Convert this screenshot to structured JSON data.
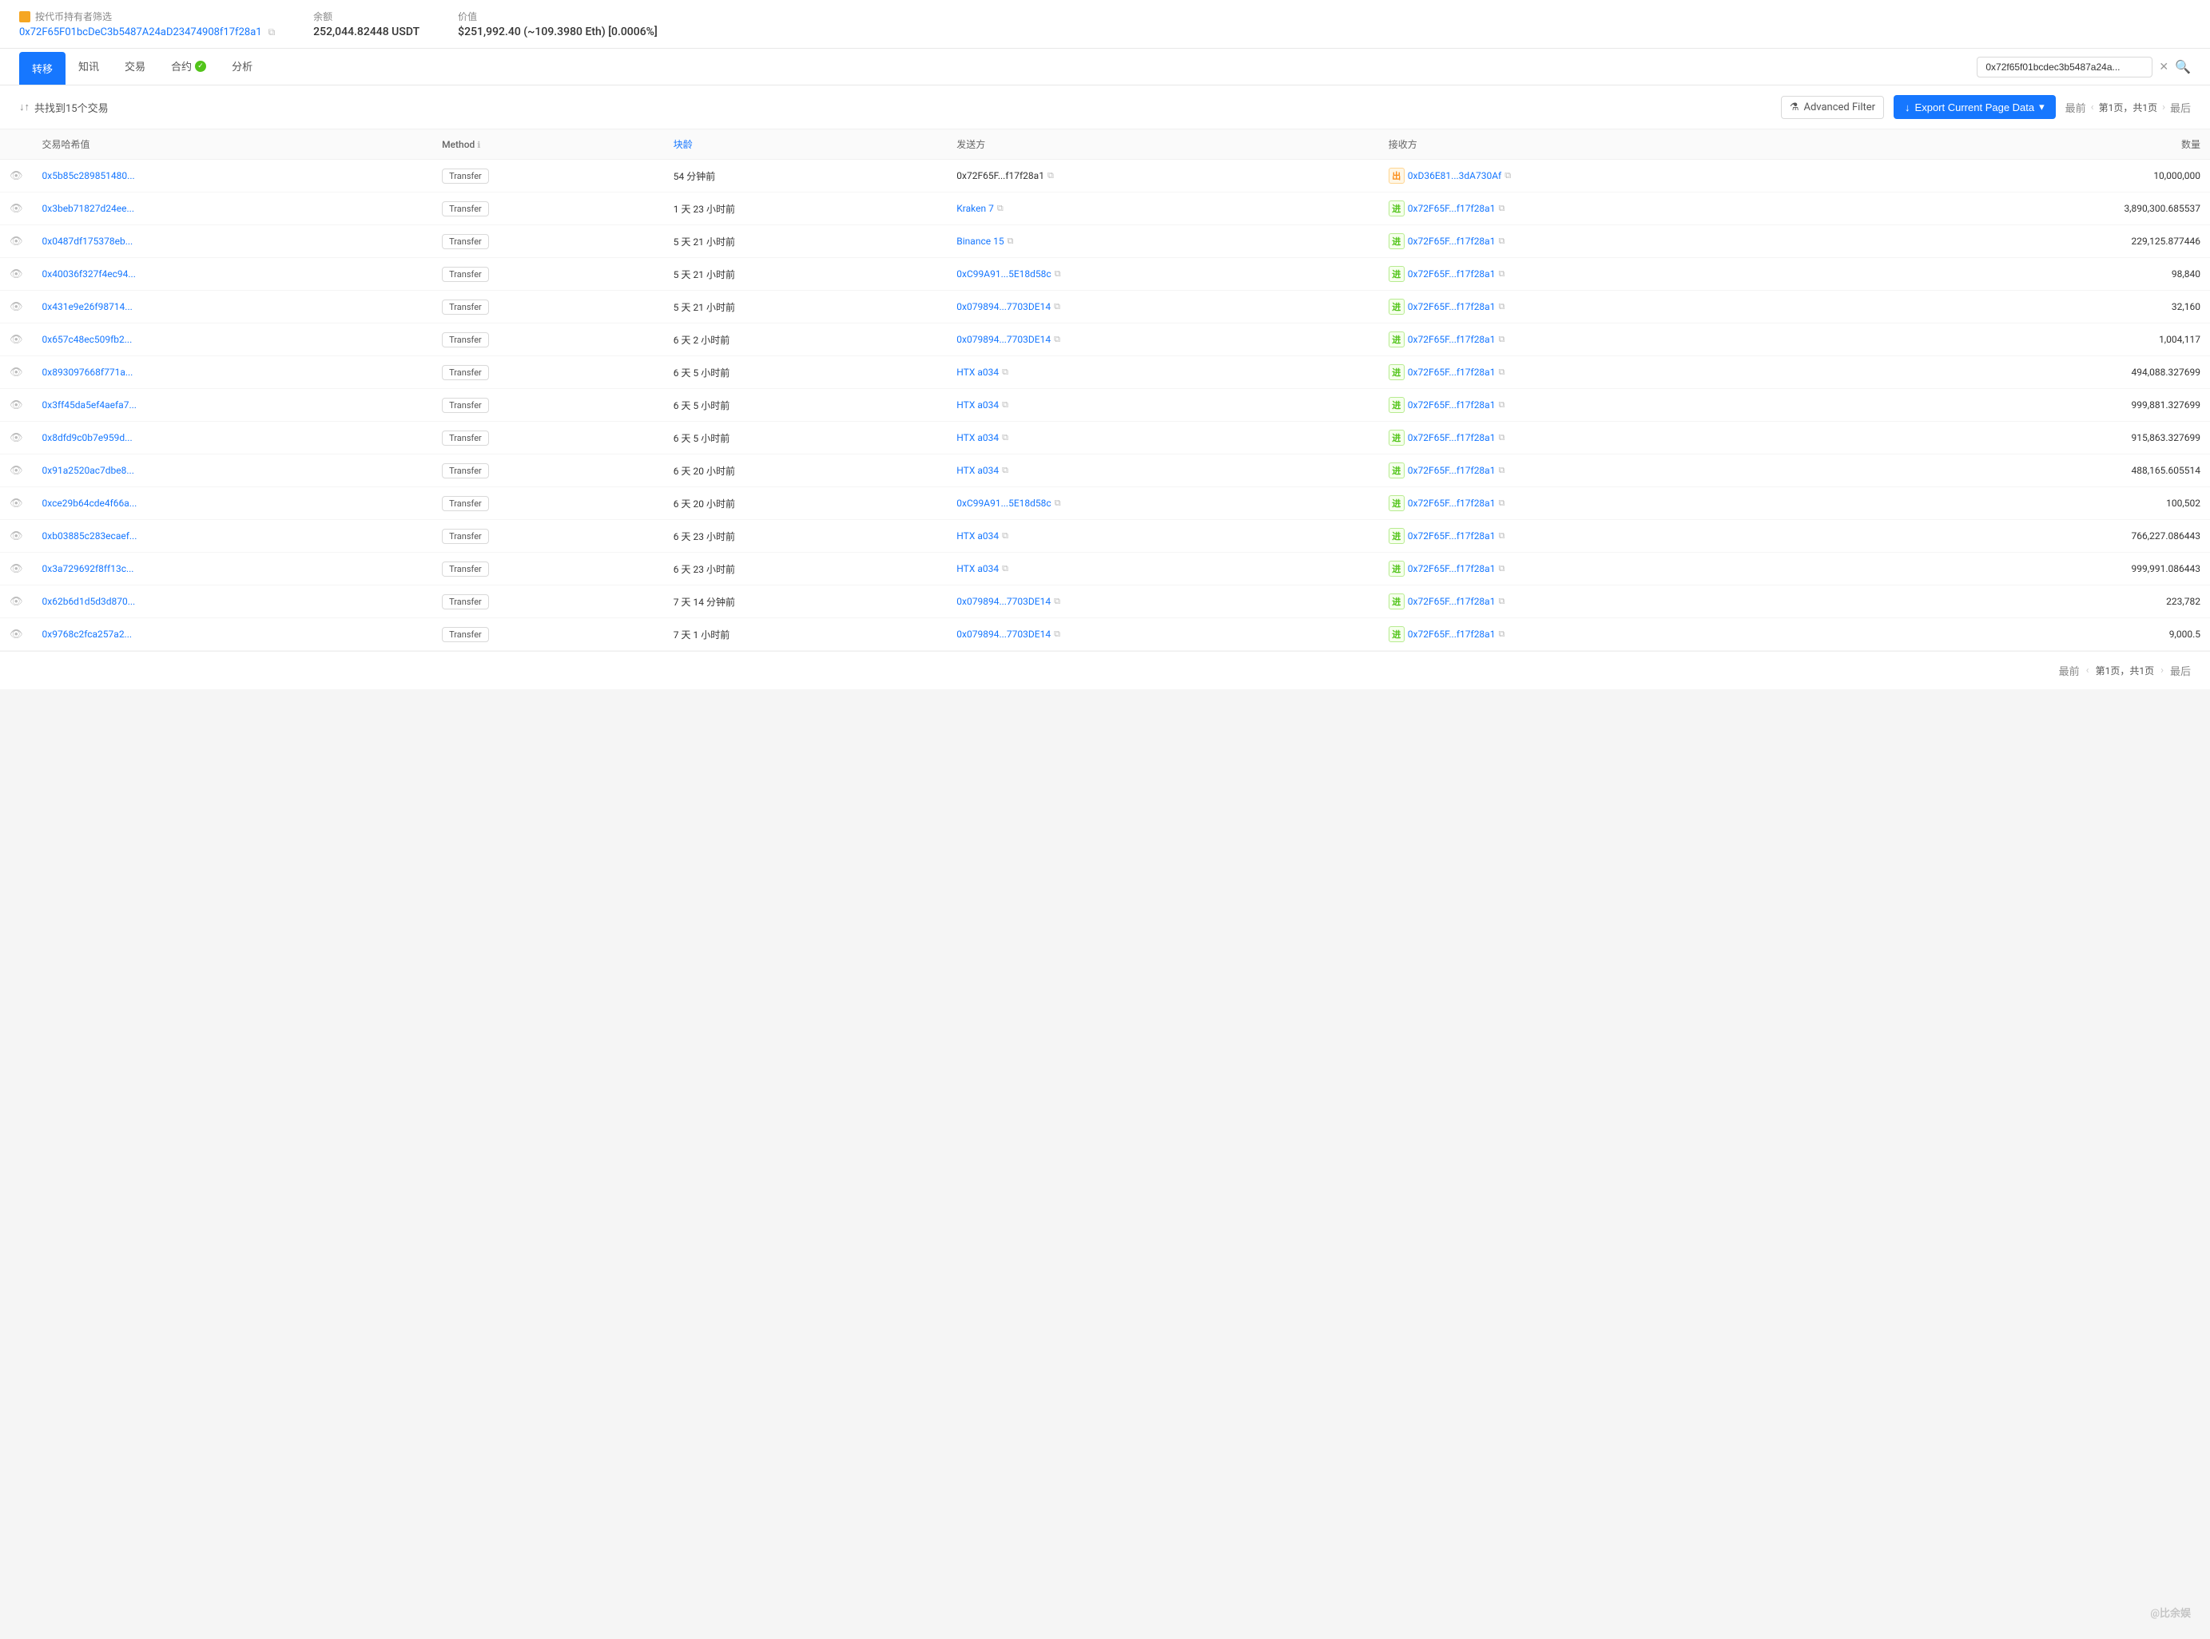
{
  "topBar": {
    "filterLabel": "按代币持有者筛选",
    "address": "0x72F65F01bcDeC3b5487A24aD23474908f17f28a1",
    "balanceLabel": "余额",
    "balanceValue": "252,044.82448 USDT",
    "valueLabel": "价值",
    "valueValue": "$251,992.40 (~109.3980 Eth) [0.0006%]"
  },
  "navTabs": [
    {
      "label": "转移",
      "active": true
    },
    {
      "label": "知讯",
      "active": false
    },
    {
      "label": "交易",
      "active": false
    },
    {
      "label": "合约",
      "active": false,
      "hasBadge": true
    },
    {
      "label": "分析",
      "active": false
    }
  ],
  "searchAddress": "0x72f65f01bcdec3b5487a24a...",
  "tableBar": {
    "sortIcon": "↓↑",
    "resultText": "共找到15个交易",
    "filterLabel": "Advanced Filter",
    "exportLabel": "Export Current Page Data",
    "firstLabel": "最前",
    "lastLabel": "最后",
    "pageInfo": "第1页，共1页"
  },
  "columns": [
    {
      "key": "eye",
      "label": ""
    },
    {
      "key": "txHash",
      "label": "交易哈希值"
    },
    {
      "key": "method",
      "label": "Method"
    },
    {
      "key": "block",
      "label": "块龄"
    },
    {
      "key": "from",
      "label": "发送方"
    },
    {
      "key": "to",
      "label": "接收方"
    },
    {
      "key": "amount",
      "label": "数量"
    }
  ],
  "rows": [
    {
      "txHash": "0x5b85c289851480...",
      "method": "Transfer",
      "block": "54 分钟前",
      "from": "0x72F65F...f17f28a1",
      "fromIsLink": false,
      "direction": "out",
      "directionLabel": "出",
      "to": "0xD36E81...3dA730Af",
      "amount": "10,000,000"
    },
    {
      "txHash": "0x3beb71827d24ee...",
      "method": "Transfer",
      "block": "1 天 23 小时前",
      "from": "Kraken 7",
      "fromIsLink": true,
      "direction": "in",
      "directionLabel": "进",
      "to": "0x72F65F...f17f28a1",
      "amount": "3,890,300.685537"
    },
    {
      "txHash": "0x0487df175378eb...",
      "method": "Transfer",
      "block": "5 天 21 小时前",
      "from": "Binance 15",
      "fromIsLink": true,
      "direction": "in",
      "directionLabel": "进",
      "to": "0x72F65F...f17f28a1",
      "amount": "229,125.877446"
    },
    {
      "txHash": "0x40036f327f4ec94...",
      "method": "Transfer",
      "block": "5 天 21 小时前",
      "from": "0xC99A91...5E18d58c",
      "fromIsLink": true,
      "direction": "in",
      "directionLabel": "进",
      "to": "0x72F65F...f17f28a1",
      "amount": "98,840"
    },
    {
      "txHash": "0x431e9e26f98714...",
      "method": "Transfer",
      "block": "5 天 21 小时前",
      "from": "0x079894...7703DE14",
      "fromIsLink": true,
      "direction": "in",
      "directionLabel": "进",
      "to": "0x72F65F...f17f28a1",
      "amount": "32,160"
    },
    {
      "txHash": "0x657c48ec509fb2...",
      "method": "Transfer",
      "block": "6 天 2 小时前",
      "from": "0x079894...7703DE14",
      "fromIsLink": true,
      "direction": "in",
      "directionLabel": "进",
      "to": "0x72F65F...f17f28a1",
      "amount": "1,004,117"
    },
    {
      "txHash": "0x893097668f771a...",
      "method": "Transfer",
      "block": "6 天 5 小时前",
      "from": "HTX a034",
      "fromIsLink": true,
      "direction": "in",
      "directionLabel": "进",
      "to": "0x72F65F...f17f28a1",
      "amount": "494,088.327699"
    },
    {
      "txHash": "0x3ff45da5ef4aefa7...",
      "method": "Transfer",
      "block": "6 天 5 小时前",
      "from": "HTX a034",
      "fromIsLink": true,
      "direction": "in",
      "directionLabel": "进",
      "to": "0x72F65F...f17f28a1",
      "amount": "999,881.327699"
    },
    {
      "txHash": "0x8dfd9c0b7e959d...",
      "method": "Transfer",
      "block": "6 天 5 小时前",
      "from": "HTX a034",
      "fromIsLink": true,
      "direction": "in",
      "directionLabel": "进",
      "to": "0x72F65F...f17f28a1",
      "amount": "915,863.327699"
    },
    {
      "txHash": "0x91a2520ac7dbe8...",
      "method": "Transfer",
      "block": "6 天 20 小时前",
      "from": "HTX a034",
      "fromIsLink": true,
      "direction": "in",
      "directionLabel": "进",
      "to": "0x72F65F...f17f28a1",
      "amount": "488,165.605514"
    },
    {
      "txHash": "0xce29b64cde4f66a...",
      "method": "Transfer",
      "block": "6 天 20 小时前",
      "from": "0xC99A91...5E18d58c",
      "fromIsLink": true,
      "direction": "in",
      "directionLabel": "进",
      "to": "0x72F65F...f17f28a1",
      "amount": "100,502"
    },
    {
      "txHash": "0xb03885c283ecaef...",
      "method": "Transfer",
      "block": "6 天 23 小时前",
      "from": "HTX a034",
      "fromIsLink": true,
      "direction": "in",
      "directionLabel": "进",
      "to": "0x72F65F...f17f28a1",
      "amount": "766,227.086443"
    },
    {
      "txHash": "0x3a729692f8ff13c...",
      "method": "Transfer",
      "block": "6 天 23 小时前",
      "from": "HTX a034",
      "fromIsLink": true,
      "direction": "in",
      "directionLabel": "进",
      "to": "0x72F65F...f17f28a1",
      "amount": "999,991.086443"
    },
    {
      "txHash": "0x62b6d1d5d3d870...",
      "method": "Transfer",
      "block": "7 天 14 分钟前",
      "from": "0x079894...7703DE14",
      "fromIsLink": true,
      "direction": "in",
      "directionLabel": "进",
      "to": "0x72F65F...f17f28a1",
      "amount": "223,782"
    },
    {
      "txHash": "0x9768c2fca257a2...",
      "method": "Transfer",
      "block": "7 天 1 小时前",
      "from": "0x079894...7703DE14",
      "fromIsLink": true,
      "direction": "in",
      "directionLabel": "进",
      "to": "0x72F65F...f17f28a1",
      "amount": "9,000.5"
    }
  ],
  "bottomPagination": {
    "firstLabel": "最前",
    "lastLabel": "最后",
    "pageInfo": "第1页，共1页",
    "watermark": "@比余娱"
  }
}
